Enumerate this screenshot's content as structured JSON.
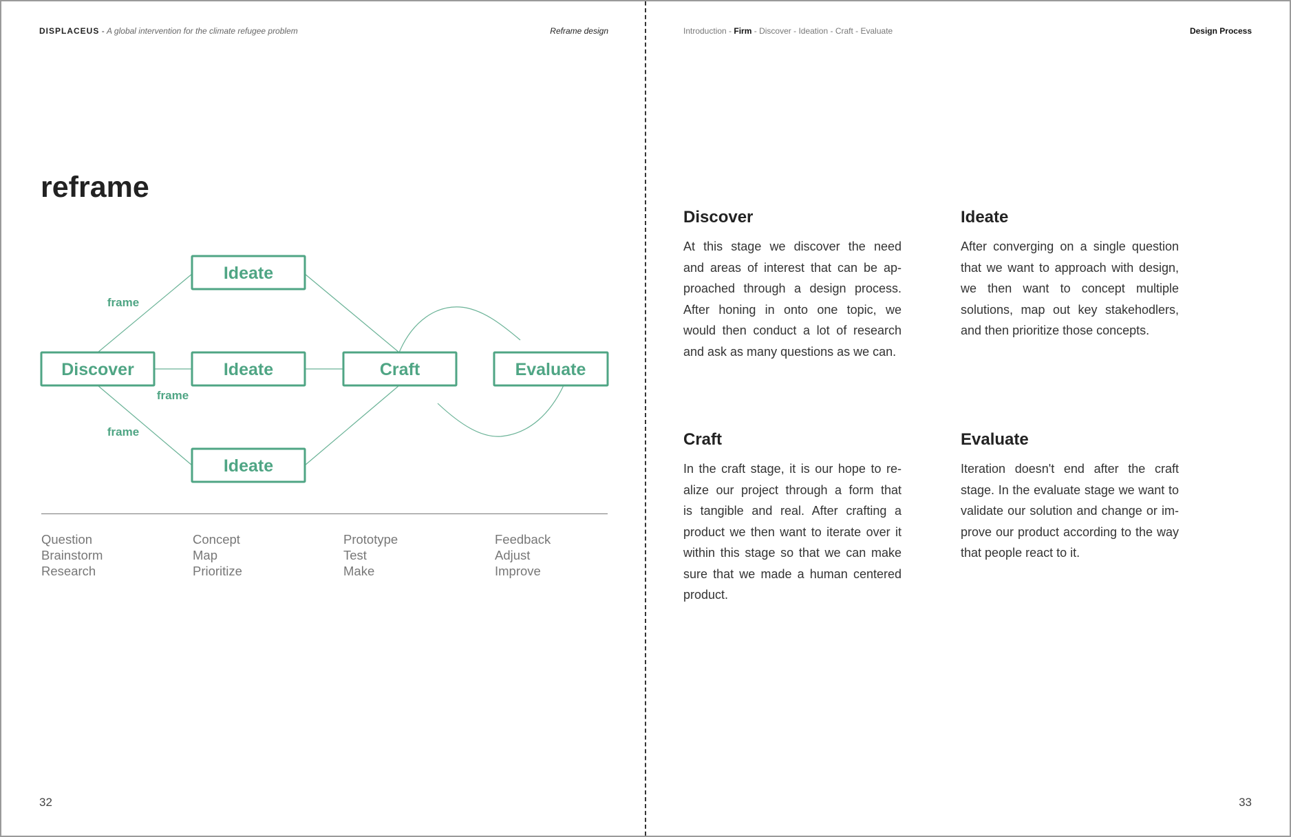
{
  "left_page": {
    "brand": "DISPLACEUS",
    "separator": "-",
    "tagline": "A global intervention for the climate refugee problem",
    "section": "Reframe design",
    "title": "reframe",
    "page_number": "32",
    "diagram": {
      "accent_color": "#4fa584",
      "nodes": {
        "discover": "Discover",
        "ideate_top": "Ideate",
        "ideate_mid": "Ideate",
        "ideate_bottom": "Ideate",
        "craft": "Craft",
        "evaluate": "Evaluate"
      },
      "edge_labels": [
        "frame",
        "frame",
        "frame"
      ]
    },
    "columns": [
      [
        "Question",
        "Brainstorm",
        "Research"
      ],
      [
        "Concept",
        "Map",
        "Prioritize"
      ],
      [
        "Prototype",
        "Test",
        "Make"
      ],
      [
        "Feedback",
        "Adjust",
        "Improve"
      ]
    ]
  },
  "right_page": {
    "breadcrumb": [
      "Introduction",
      "Firm",
      "Discover",
      "Ideation",
      "Craft",
      "Evaluate"
    ],
    "breadcrumb_active": "Firm",
    "section": "Design Process",
    "page_number": "33",
    "sections": [
      {
        "heading": "Discover",
        "lines": [
          "At this stage we discover the need",
          "and areas of interest that can be ap-",
          "proached through a design process.",
          "After honing in onto one topic, we",
          "would then conduct a lot of research",
          "and ask as many questions as we can."
        ]
      },
      {
        "heading": "Ideate",
        "lines": [
          "After converging on a single question",
          "that we want to approach with design,",
          "we then want to concept multiple",
          "solutions, map out key stakehodlers,",
          "and then prioritize those concepts."
        ]
      },
      {
        "heading": "Craft",
        "lines": [
          "In the craft stage, it is our hope to re-",
          "alize our project through a form that",
          "is tangible and real. After crafting a",
          "product we then want to iterate over it",
          "within this stage so that we can make",
          "sure that we made a human centered",
          "product."
        ]
      },
      {
        "heading": "Evaluate",
        "lines": [
          "Iteration doesn't end after the craft",
          "stage. In the evaluate stage we want to",
          "validate our solution and change or im-",
          "prove our product according to the way",
          "that people react to it."
        ]
      }
    ]
  }
}
